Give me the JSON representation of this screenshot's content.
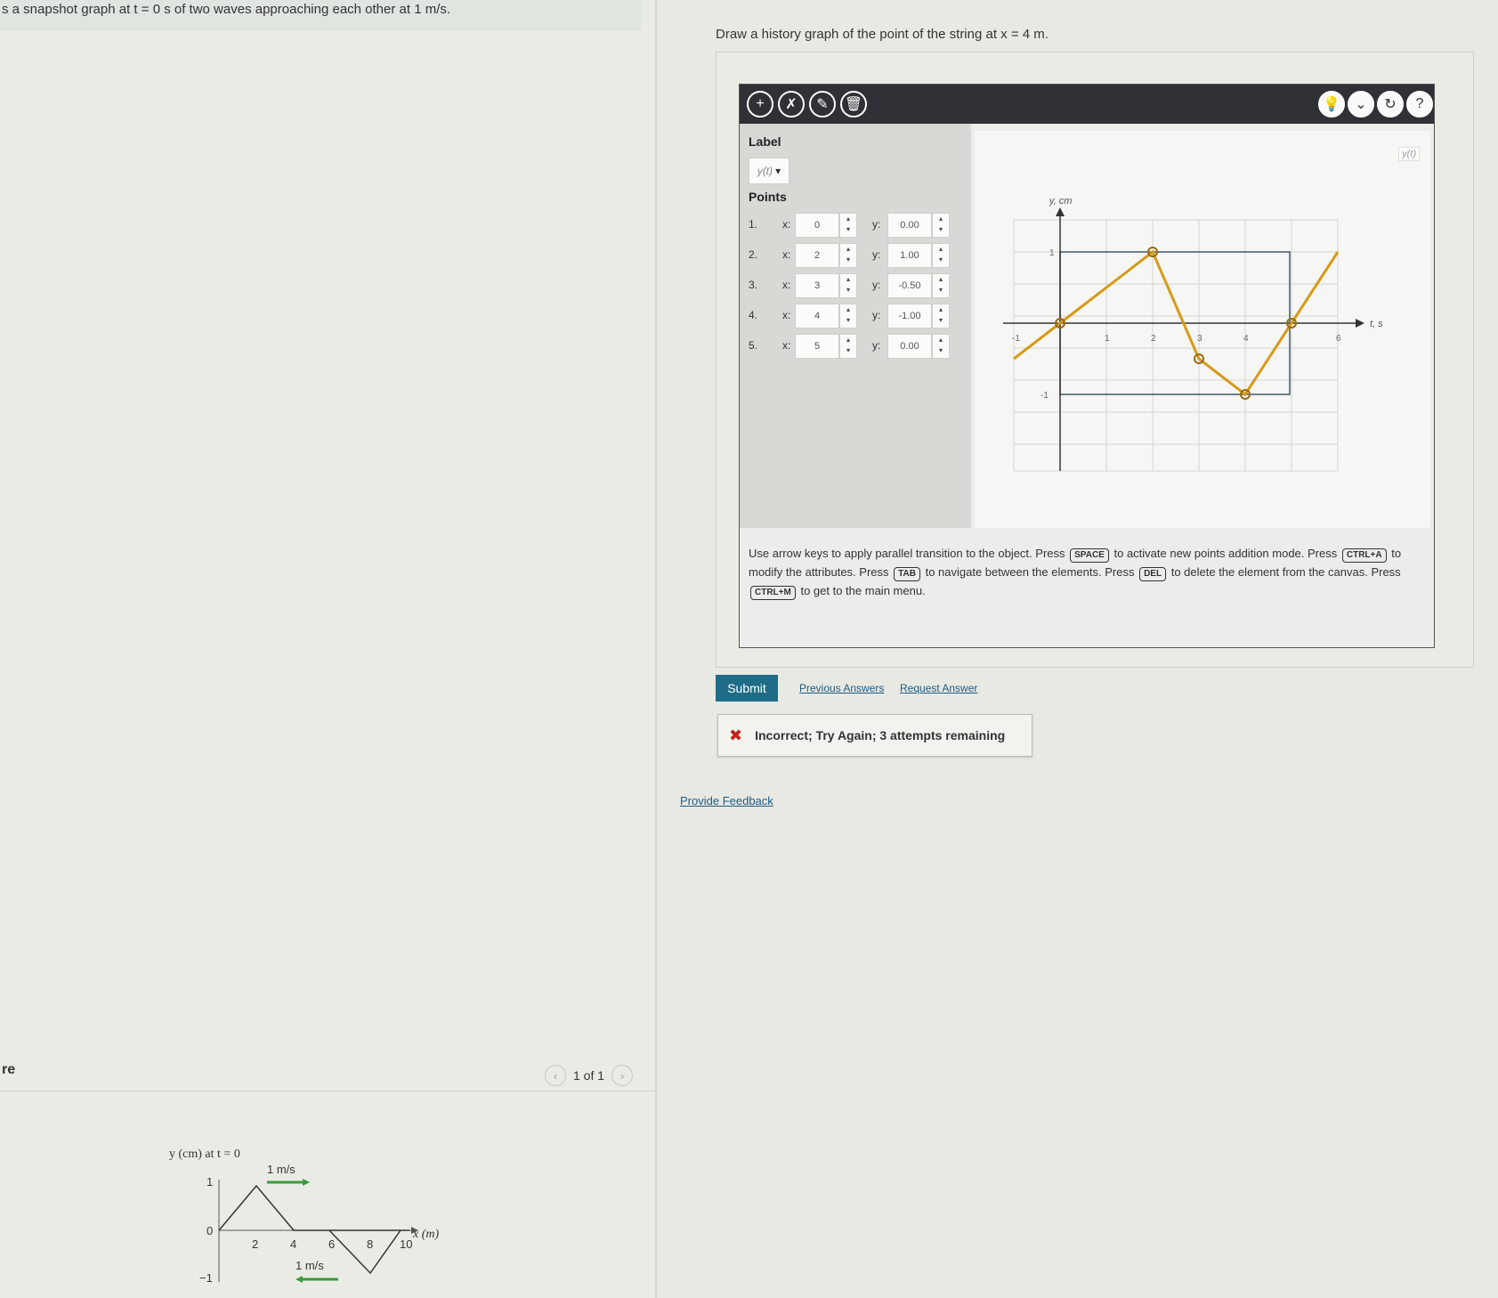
{
  "left": {
    "header": "s a snapshot graph at t = 0 s of two waves approaching each other at 1 m/s.",
    "section_label": "re",
    "pager": {
      "text": "1 of 1",
      "prev_icon": "chevron-left-icon",
      "next_icon": "chevron-right-icon"
    },
    "snapshot": {
      "title": "y (cm) at t = 0",
      "x_axis_label": "x (m)",
      "y_ticks": [
        "1",
        "0",
        "−1"
      ],
      "x_ticks": [
        "2",
        "4",
        "6",
        "8",
        "10"
      ],
      "wave_right_speed": "1 m/s",
      "wave_left_speed": "1 m/s",
      "arrow_right_color": "#3a9a3a",
      "arrow_left_color": "#3a9a3a"
    }
  },
  "right": {
    "question": "Draw a history graph of the point of the string at x = 4 m.",
    "toolbar": {
      "left_icons": [
        "plus-icon",
        "no-draw-icon",
        "pencil-icon",
        "trash-icon"
      ],
      "right_icons": [
        "hint-bulb-icon",
        "chevron-down-icon",
        "reset-icon",
        "help-icon"
      ]
    },
    "side": {
      "label_heading": "Label",
      "label_value": "y(t)",
      "points_heading": "Points",
      "x_label": "x:",
      "y_label": "y:",
      "points": [
        {
          "idx": "1.",
          "x": "0",
          "y": "0.00"
        },
        {
          "idx": "2.",
          "x": "2",
          "y": "1.00"
        },
        {
          "idx": "3.",
          "x": "3",
          "y": "-0.50"
        },
        {
          "idx": "4.",
          "x": "4",
          "y": "-1.00"
        },
        {
          "idx": "5.",
          "x": "5",
          "y": "0.00"
        }
      ]
    },
    "graph": {
      "y_axis_label": "y, cm",
      "x_axis_label": "t, s",
      "tag": "y(t)",
      "x_ticks": [
        "-1",
        "1",
        "2",
        "3",
        "4",
        "6"
      ],
      "y_ticks": [
        "1",
        "-1"
      ],
      "line_color": "#d79a18"
    },
    "instructions": {
      "t1": "Use arrow keys to apply parallel transition to the object. Press",
      "k1": "SPACE",
      "t2": "to activate new points addition mode. Press",
      "k2": "CTRL+A",
      "t3": "to modify the attributes. Press",
      "k3": "TAB",
      "t4": "to navigate between the elements. Press",
      "k4": "DEL",
      "t5": "to delete the element from the canvas. Press",
      "k5": "CTRL+M",
      "t6": "to get to the main menu."
    },
    "submit_label": "Submit",
    "previous_answers": "Previous Answers",
    "request_answer": "Request Answer",
    "feedback": "Incorrect; Try Again; 3 attempts remaining",
    "provide_feedback": "Provide Feedback",
    "error_color": "#c0231b",
    "submit_color": "#1f6c86"
  }
}
